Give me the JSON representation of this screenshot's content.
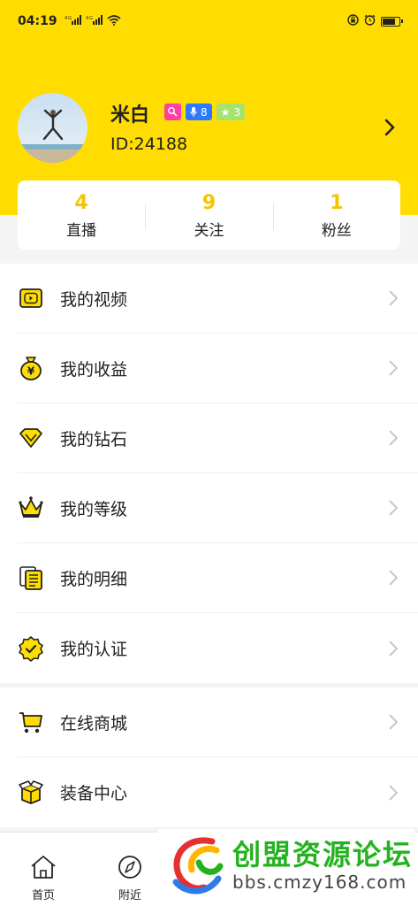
{
  "status": {
    "time": "04:19",
    "signal1": "4G",
    "signal2": "4G"
  },
  "profile": {
    "name": "米白",
    "id_text": "ID:24188",
    "badge_mic_level": "8",
    "badge_star_level": "3"
  },
  "stats": [
    {
      "value": "4",
      "label": "直播"
    },
    {
      "value": "9",
      "label": "关注"
    },
    {
      "value": "1",
      "label": "粉丝"
    }
  ],
  "menu_primary": [
    {
      "label": "我的视频",
      "icon": "video-icon"
    },
    {
      "label": "我的收益",
      "icon": "money-bag-icon"
    },
    {
      "label": "我的钻石",
      "icon": "diamond-icon"
    },
    {
      "label": "我的等级",
      "icon": "crown-icon"
    },
    {
      "label": "我的明细",
      "icon": "details-icon"
    },
    {
      "label": "我的认证",
      "icon": "verified-icon"
    }
  ],
  "menu_secondary": [
    {
      "label": "在线商城",
      "icon": "cart-icon"
    },
    {
      "label": "装备中心",
      "icon": "box-icon"
    }
  ],
  "tabbar": [
    {
      "label": "首页",
      "icon": "home-icon"
    },
    {
      "label": "附近",
      "icon": "compass-icon"
    }
  ],
  "watermark": {
    "title": "创盟资源论坛",
    "url": "bbs.cmzy168.com"
  },
  "colors": {
    "brand_yellow": "#ffdd00",
    "stat_number": "#f5c400",
    "watermark_green": "#23b31e"
  }
}
